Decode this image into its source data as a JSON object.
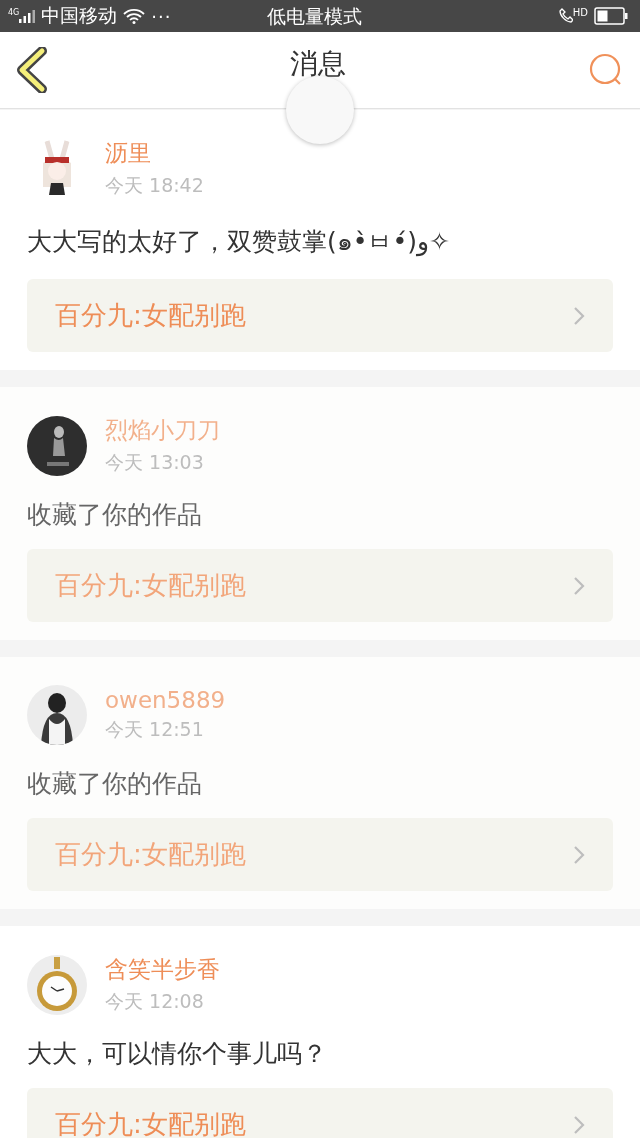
{
  "status_bar": {
    "network": "4G",
    "carrier": "中国移动",
    "dots": "···",
    "mode": "低电量模式",
    "call_badge": "HD"
  },
  "header": {
    "title": "消息"
  },
  "messages": [
    {
      "name": "沥里",
      "time": "今天 18:42",
      "text": "大大写的太好了，双赞鼓掌(๑•̀ㅂ•́)و✧",
      "work": "百分九:女配别跑",
      "dimmed": false
    },
    {
      "name": "烈焰小刀刀",
      "time": "今天 13:03",
      "text": "收藏了你的作品",
      "work": "百分九:女配别跑",
      "dimmed": true
    },
    {
      "name": "owen5889",
      "time": "今天 12:51",
      "text": "收藏了你的作品",
      "work": "百分九:女配别跑",
      "dimmed": true
    },
    {
      "name": "含笑半步香",
      "time": "今天 12:08",
      "text": "大大，可以情你个事儿吗？",
      "work": "百分九:女配别跑",
      "dimmed": false
    }
  ]
}
